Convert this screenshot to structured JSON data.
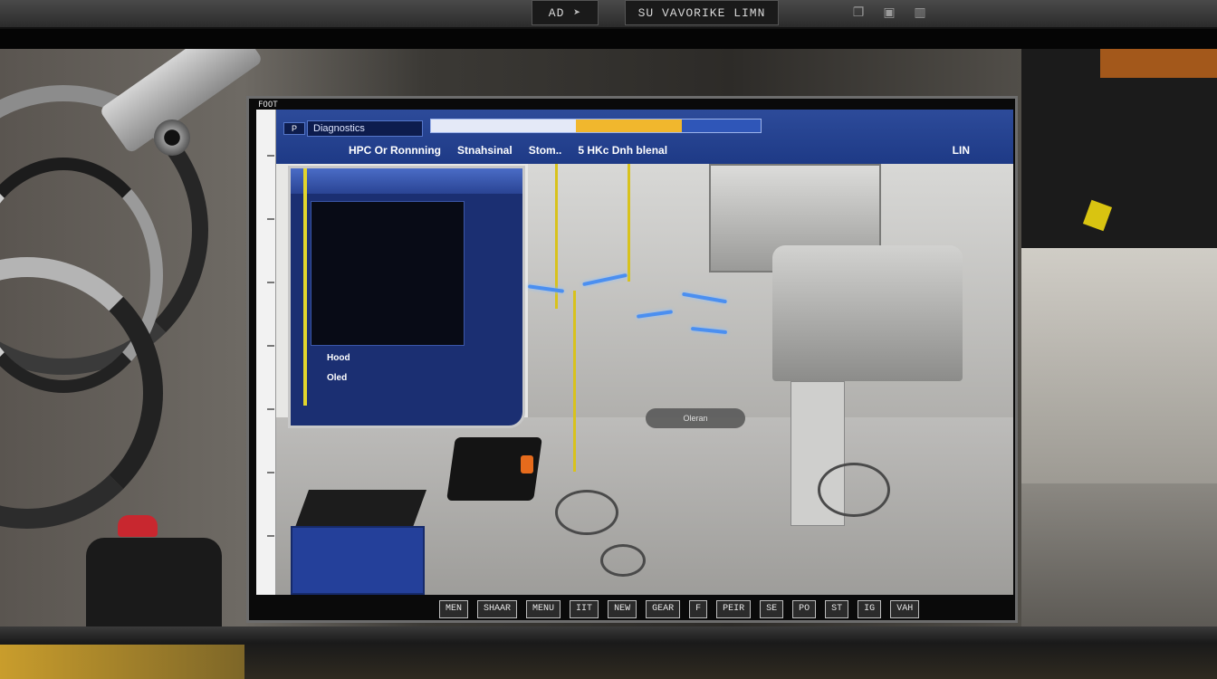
{
  "topbar": {
    "left_label": "AD",
    "left_icon": "play-arrow-icon",
    "mid_label": "SU VAVORIKE LIMN",
    "icons": [
      "copy-icon",
      "window-icon",
      "trash-icon"
    ]
  },
  "monitor": {
    "tag": "FOOT",
    "header": {
      "app_label": "P",
      "title_box": "Diagnostics",
      "progress_white": 0.44,
      "progress_yellow": 0.55,
      "accent_color": "#f1b72d",
      "menu": [
        "HPC Or Ronnning",
        "Stnahsinal",
        "Stom..",
        "5 HKc Dnh blenal"
      ],
      "right_label": "LIN"
    },
    "inner_window": {
      "title": "",
      "labels": [
        "Hood",
        "Oled"
      ]
    },
    "overlay_chip": "Oleran",
    "bottom_bar": [
      "MEN",
      "SHAAR",
      "MENU",
      "IIT",
      "NEW",
      "GEAR",
      "F",
      "PEIR",
      "SE",
      "PO",
      "ST",
      "IG",
      "VAH"
    ]
  }
}
